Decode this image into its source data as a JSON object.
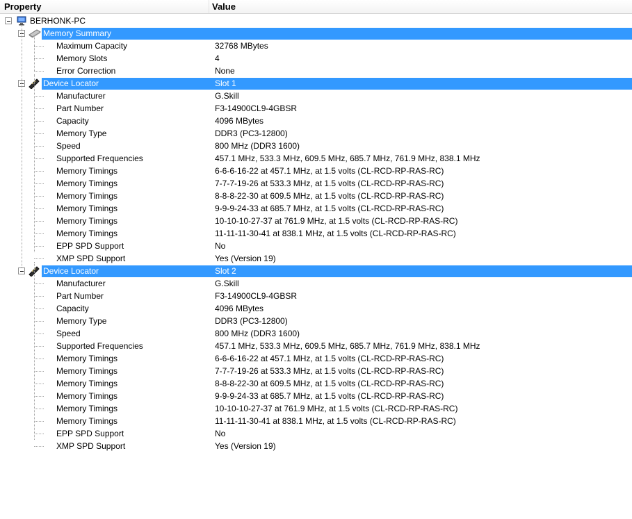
{
  "header": {
    "property": "Property",
    "value": "Value"
  },
  "root": {
    "label": "BERHONK-PC",
    "icon": "computer-icon"
  },
  "summary": {
    "label": "Memory Summary",
    "icon": "memory-module-icon",
    "rows": [
      {
        "prop": "Maximum Capacity",
        "value": "32768 MBytes"
      },
      {
        "prop": "Memory Slots",
        "value": "4"
      },
      {
        "prop": "Error Correction",
        "value": "None"
      }
    ]
  },
  "devices": [
    {
      "label": "Device Locator",
      "value": "Slot 1",
      "icon": "ram-stick-icon",
      "rows": [
        {
          "prop": "Manufacturer",
          "value": "G.Skill"
        },
        {
          "prop": "Part Number",
          "value": "F3-14900CL9-4GBSR"
        },
        {
          "prop": "Capacity",
          "value": "4096 MBytes"
        },
        {
          "prop": "Memory Type",
          "value": "DDR3 (PC3-12800)"
        },
        {
          "prop": "Speed",
          "value": "800 MHz (DDR3 1600)"
        },
        {
          "prop": "Supported Frequencies",
          "value": "457.1 MHz, 533.3 MHz, 609.5 MHz, 685.7 MHz, 761.9 MHz, 838.1 MHz"
        },
        {
          "prop": "Memory Timings",
          "value": "6-6-6-16-22 at 457.1 MHz, at 1.5 volts (CL-RCD-RP-RAS-RC)"
        },
        {
          "prop": "Memory Timings",
          "value": "7-7-7-19-26 at 533.3 MHz, at 1.5 volts (CL-RCD-RP-RAS-RC)"
        },
        {
          "prop": "Memory Timings",
          "value": "8-8-8-22-30 at 609.5 MHz, at 1.5 volts (CL-RCD-RP-RAS-RC)"
        },
        {
          "prop": "Memory Timings",
          "value": "9-9-9-24-33 at 685.7 MHz, at 1.5 volts (CL-RCD-RP-RAS-RC)"
        },
        {
          "prop": "Memory Timings",
          "value": "10-10-10-27-37 at 761.9 MHz, at 1.5 volts (CL-RCD-RP-RAS-RC)"
        },
        {
          "prop": "Memory Timings",
          "value": "11-11-11-30-41 at 838.1 MHz, at 1.5 volts (CL-RCD-RP-RAS-RC)"
        },
        {
          "prop": "EPP SPD Support",
          "value": "No"
        },
        {
          "prop": "XMP SPD Support",
          "value": "Yes (Version 19)"
        }
      ]
    },
    {
      "label": "Device Locator",
      "value": "Slot 2",
      "icon": "ram-stick-icon",
      "rows": [
        {
          "prop": "Manufacturer",
          "value": "G.Skill"
        },
        {
          "prop": "Part Number",
          "value": "F3-14900CL9-4GBSR"
        },
        {
          "prop": "Capacity",
          "value": "4096 MBytes"
        },
        {
          "prop": "Memory Type",
          "value": "DDR3 (PC3-12800)"
        },
        {
          "prop": "Speed",
          "value": "800 MHz (DDR3 1600)"
        },
        {
          "prop": "Supported Frequencies",
          "value": "457.1 MHz, 533.3 MHz, 609.5 MHz, 685.7 MHz, 761.9 MHz, 838.1 MHz"
        },
        {
          "prop": "Memory Timings",
          "value": "6-6-6-16-22 at 457.1 MHz, at 1.5 volts (CL-RCD-RP-RAS-RC)"
        },
        {
          "prop": "Memory Timings",
          "value": "7-7-7-19-26 at 533.3 MHz, at 1.5 volts (CL-RCD-RP-RAS-RC)"
        },
        {
          "prop": "Memory Timings",
          "value": "8-8-8-22-30 at 609.5 MHz, at 1.5 volts (CL-RCD-RP-RAS-RC)"
        },
        {
          "prop": "Memory Timings",
          "value": "9-9-9-24-33 at 685.7 MHz, at 1.5 volts (CL-RCD-RP-RAS-RC)"
        },
        {
          "prop": "Memory Timings",
          "value": "10-10-10-27-37 at 761.9 MHz, at 1.5 volts (CL-RCD-RP-RAS-RC)"
        },
        {
          "prop": "Memory Timings",
          "value": "11-11-11-30-41 at 838.1 MHz, at 1.5 volts (CL-RCD-RP-RAS-RC)"
        },
        {
          "prop": "EPP SPD Support",
          "value": "No"
        },
        {
          "prop": "XMP SPD Support",
          "value": "Yes (Version 19)"
        }
      ]
    }
  ],
  "colors": {
    "selection": "#3399ff",
    "tree_line": "#a0a0a0"
  }
}
